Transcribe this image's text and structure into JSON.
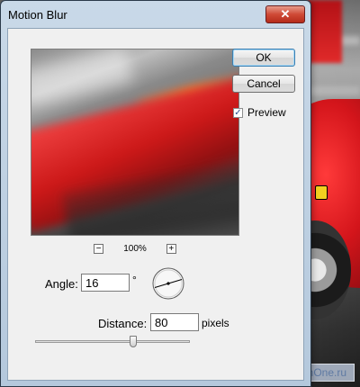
{
  "dialog": {
    "title": "Motion Blur",
    "close_glyph": "✕",
    "ok_label": "OK",
    "cancel_label": "Cancel",
    "preview_label": "Preview",
    "preview_checked": true,
    "zoom": {
      "minus": "−",
      "level": "100%",
      "plus": "+"
    },
    "angle": {
      "label": "Angle:",
      "value": "16",
      "unit": "°"
    },
    "distance": {
      "label": "Distance:",
      "value": "80",
      "unit": "pixels"
    },
    "distance_slider": {
      "min": 1,
      "max": 999,
      "value": 80
    }
  },
  "watermark": "GolDenOne.ru",
  "icons": [
    "close-icon",
    "zoom-out-icon",
    "zoom-in-icon",
    "checkmark-icon",
    "angle-dial-icon"
  ]
}
